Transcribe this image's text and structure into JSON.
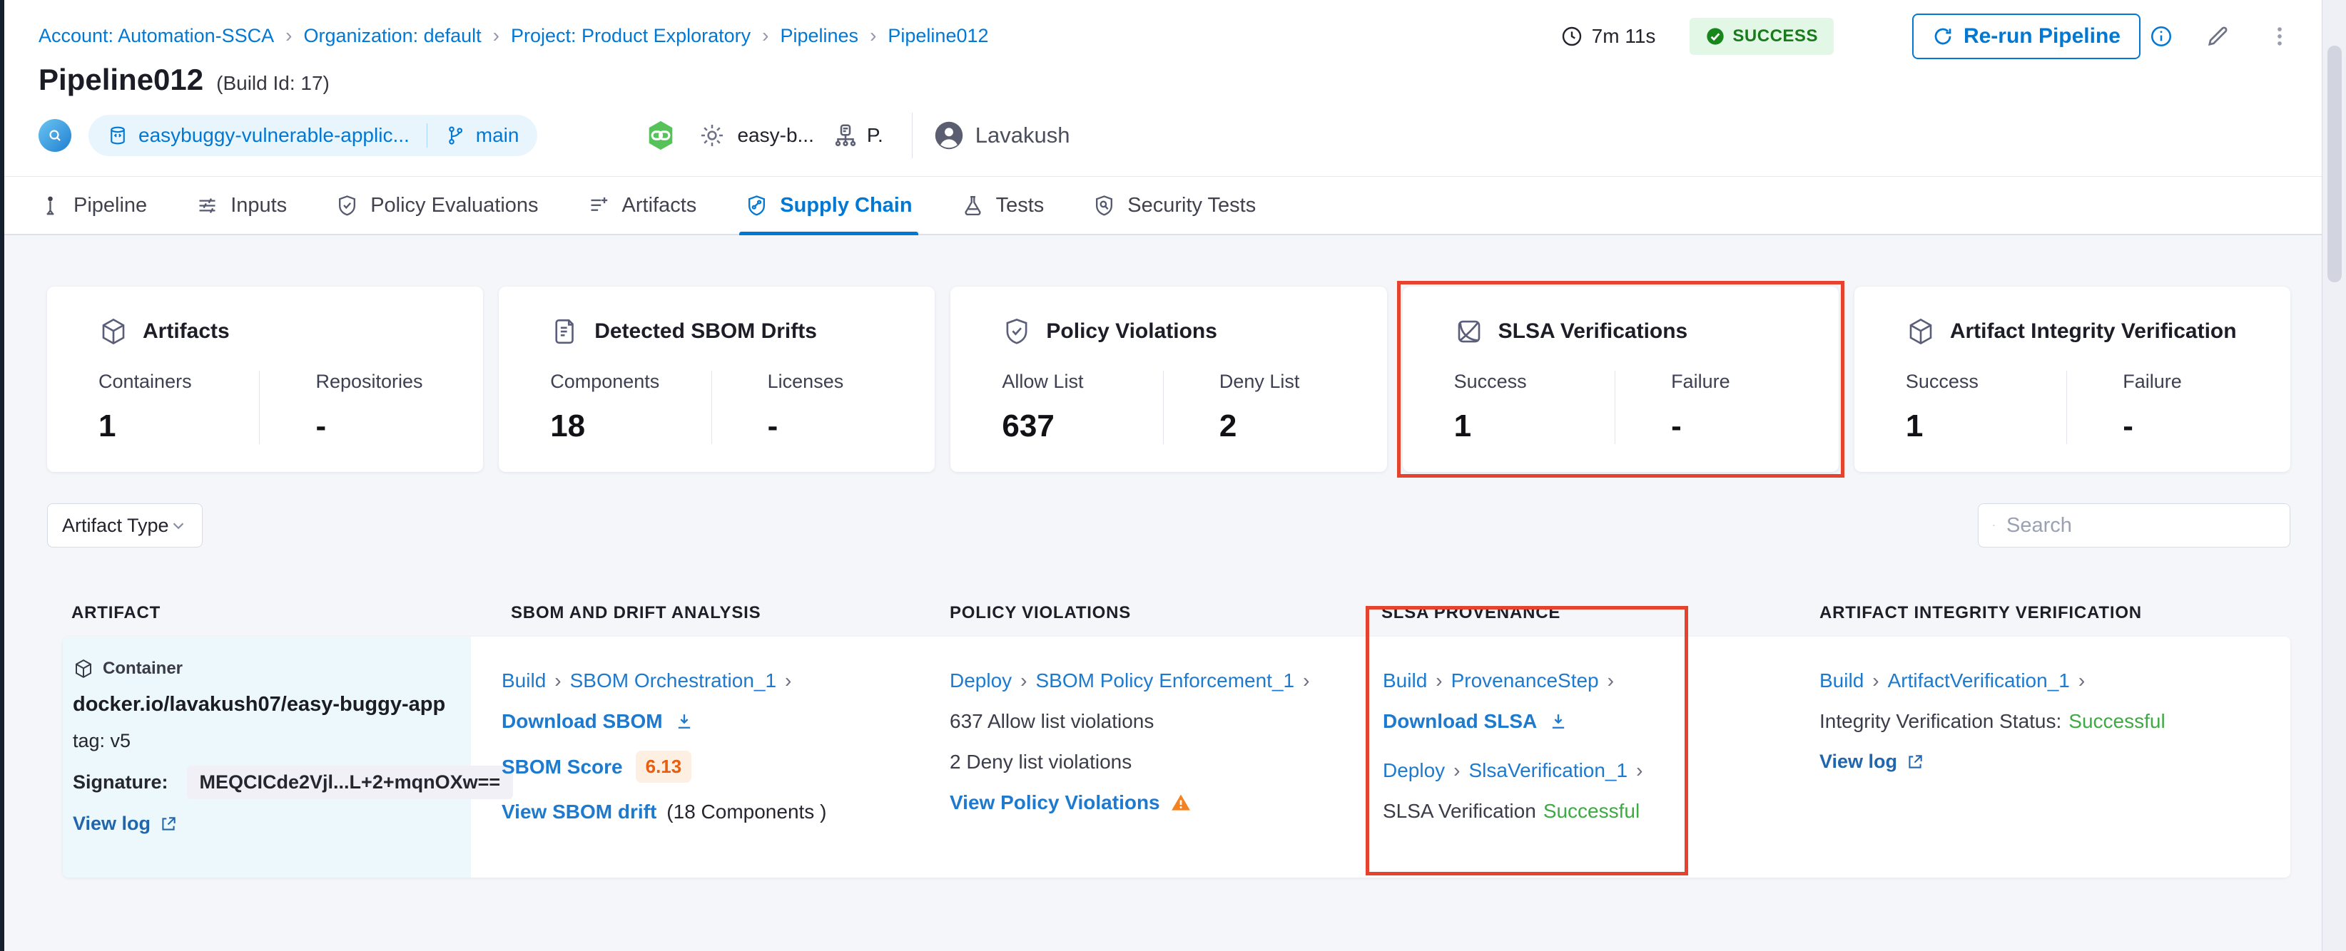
{
  "glyphs": {
    "chevron": "›"
  },
  "breadcrumb": {
    "separator": "›",
    "items": [
      "Account: Automation-SSCA",
      "Organization: default",
      "Project: Product Exploratory",
      "Pipelines",
      "Pipeline012"
    ]
  },
  "run_header": {
    "title": "Pipeline012",
    "build_id": "(Build Id: 17)",
    "duration": "7m 11s",
    "status_label": "SUCCESS",
    "rerun_label": "Re-run Pipeline"
  },
  "meta": {
    "repo_name": "easybuggy-vulnerable-applic...",
    "branch": "main",
    "service": "easy-b...",
    "env": "P.",
    "user": "Lavakush"
  },
  "tabs": [
    {
      "label": "Pipeline"
    },
    {
      "label": "Inputs"
    },
    {
      "label": "Policy Evaluations"
    },
    {
      "label": "Artifacts"
    },
    {
      "label": "Supply Chain",
      "active": true
    },
    {
      "label": "Tests"
    },
    {
      "label": "Security Tests"
    }
  ],
  "cards": [
    {
      "title": "Artifacts",
      "stats": [
        {
          "label": "Containers",
          "value": "1"
        },
        {
          "label": "Repositories",
          "value": "-"
        }
      ]
    },
    {
      "title": "Detected SBOM Drifts",
      "stats": [
        {
          "label": "Components",
          "value": "18"
        },
        {
          "label": "Licenses",
          "value": "-"
        }
      ]
    },
    {
      "title": "Policy Violations",
      "stats": [
        {
          "label": "Allow List",
          "value": "637"
        },
        {
          "label": "Deny List",
          "value": "2"
        }
      ]
    },
    {
      "title": "SLSA Verifications",
      "highlighted": true,
      "stats": [
        {
          "label": "Success",
          "value": "1"
        },
        {
          "label": "Failure",
          "value": "-"
        }
      ]
    },
    {
      "title": "Artifact Integrity Verification",
      "stats": [
        {
          "label": "Success",
          "value": "1"
        },
        {
          "label": "Failure",
          "value": "-"
        }
      ]
    }
  ],
  "filters": {
    "artifact_type": "Artifact Type",
    "search_placeholder": "Search"
  },
  "table": {
    "headers": [
      "ARTIFACT",
      "SBOM AND DRIFT ANALYSIS",
      "POLICY VIOLATIONS",
      "SLSA PROVENANCE",
      "ARTIFACT INTEGRITY VERIFICATION"
    ],
    "row": {
      "artifact": {
        "badge": "Container",
        "image": "docker.io/lavakush07/easy-buggy-app",
        "tag": "tag: v5",
        "signature_label": "Signature:",
        "signature": "MEQCICde2Vjl...L+2+mqnOXw==",
        "view_log": "View log"
      },
      "sbom": {
        "stage": "Build",
        "step": "SBOM Orchestration_1",
        "download": "Download SBOM",
        "score_label": "SBOM Score",
        "score": "6.13",
        "drift": "View SBOM drift",
        "components": "(18 Components )"
      },
      "policy": {
        "stage": "Deploy",
        "step": "SBOM Policy Enforcement_1",
        "allow": "637 Allow list violations",
        "deny": "2 Deny list violations",
        "view": "View Policy Violations"
      },
      "slsa": {
        "stage1": "Build",
        "step1": "ProvenanceStep",
        "download": "Download SLSA",
        "stage2": "Deploy",
        "step2": "SlsaVerification_1",
        "status_label": "SLSA Verification",
        "status": "Successful"
      },
      "integrity": {
        "stage": "Build",
        "step": "ArtifactVerification_1",
        "status_label": "Integrity Verification Status:",
        "status": "Successful",
        "view_log": "View log"
      }
    }
  },
  "colors": {
    "accent": "#0278d5",
    "success_text": "#187a1b",
    "success_bg": "#e3f7e6",
    "status_green": "#3eaa44",
    "score_orange": "#e85e0e",
    "annotation_red": "#e5432e"
  }
}
